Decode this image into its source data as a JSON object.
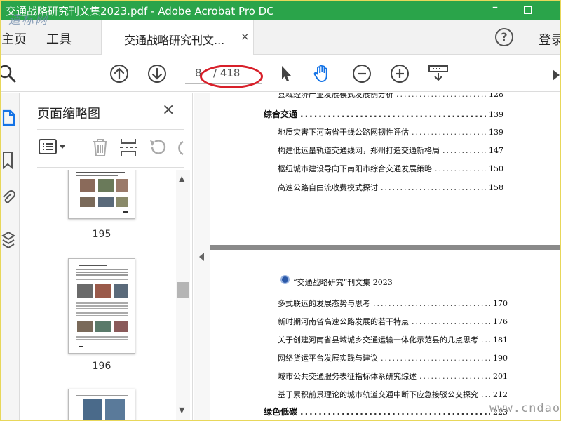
{
  "window": {
    "title": "交通战略研究刊文集2023.pdf - Adobe Acrobat Pro DC",
    "minimize": "–",
    "watermark_text": "道标网"
  },
  "menubar": {
    "home_label": "主页",
    "tools_label": "工具",
    "tab_label": "交通战略研究刊文...",
    "tab_close": "×",
    "help": "?",
    "signin": "登录"
  },
  "toolbar": {
    "current_page": "8",
    "total_pages": "/ 418",
    "icons": [
      "search-icon",
      "page-up-icon",
      "page-down-icon",
      "select-cursor-icon",
      "hand-tool-icon",
      "zoom-out-icon",
      "zoom-in-icon",
      "scroll-mode-icon"
    ],
    "accent_color": "#1473e6",
    "highlight_color": "#d8202a"
  },
  "thumbnails_panel": {
    "title": "页面缩略图",
    "close": "×",
    "pages": [
      {
        "number": "195"
      },
      {
        "number": "196"
      }
    ]
  },
  "document": {
    "cut_line": "县域经济产业发展模式发展例分析",
    "cut_page": "128",
    "section1": {
      "label": "综合交通",
      "page": "139"
    },
    "entries_top": [
      {
        "title": "地质灾害下河南省干线公路网韧性评估",
        "page": "139"
      },
      {
        "title": "构建低运量轨道交通线网，郑州打造交通新格局",
        "page": "147"
      },
      {
        "title": "枢纽城市建设导向下南阳市综合交通发展策略",
        "page": "150"
      },
      {
        "title": "高速公路自由流收费模式探讨",
        "page": "158"
      }
    ],
    "header": "“交通战略研究”刊文集 2023",
    "entries_bottom": [
      {
        "title": "多式联运的发展态势与思考",
        "page": "170"
      },
      {
        "title": "新时期河南省高速公路发展的若干特点",
        "page": "176"
      },
      {
        "title": "关于创建河南省县域城乡交通运输一体化示范县的几点思考",
        "page": "181"
      },
      {
        "title": "网络货运平台发展实践与建议",
        "page": "190"
      },
      {
        "title": "城市公共交通服务表征指标体系研究综述",
        "page": "201"
      },
      {
        "title": "基于累积前景理论的城市轨道交通中断下应急接驳公交探究",
        "page": "212"
      }
    ],
    "section2": {
      "label": "绿色低碳",
      "page": "223"
    }
  },
  "site_watermark": "www.cndao.com"
}
